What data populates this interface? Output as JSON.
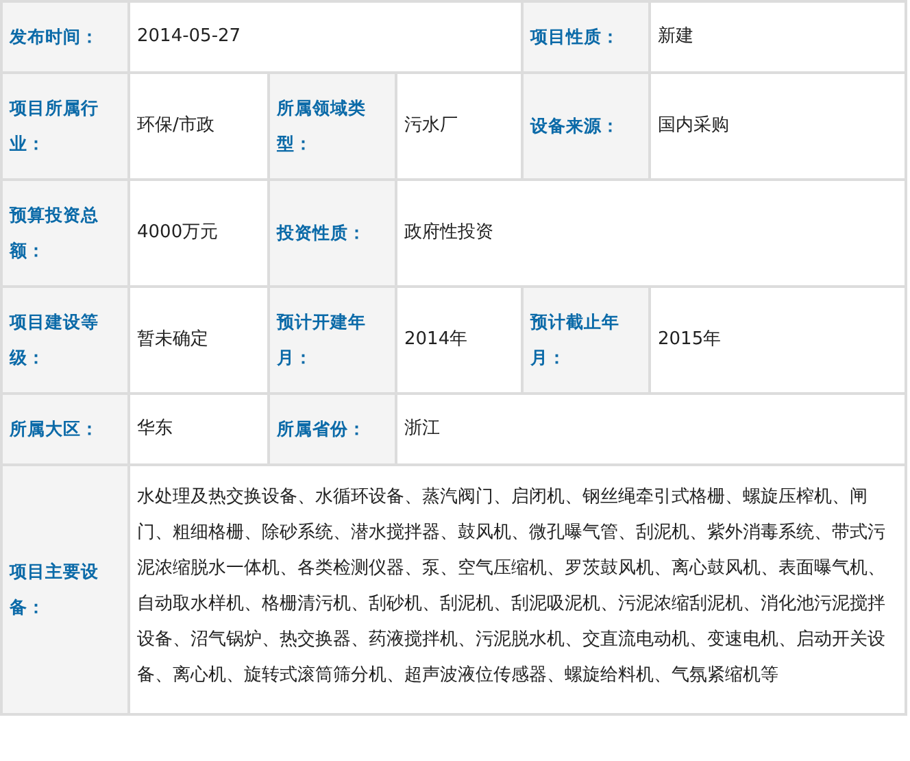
{
  "rows": [
    [
      {
        "kind": "label",
        "text": "发布时间："
      },
      {
        "kind": "value",
        "text": "2014-05-27"
      },
      {
        "kind": "label",
        "text": "项目性质："
      },
      {
        "kind": "value",
        "text": "新建"
      }
    ],
    [
      {
        "kind": "label",
        "text": "项目所属行业："
      },
      {
        "kind": "value",
        "text": "环保/市政"
      },
      {
        "kind": "label",
        "text": "所属领域类型："
      },
      {
        "kind": "value",
        "text": "污水厂"
      },
      {
        "kind": "label",
        "text": "设备来源："
      },
      {
        "kind": "value",
        "text": "国内采购"
      }
    ],
    [
      {
        "kind": "label",
        "text": "预算投资总额："
      },
      {
        "kind": "value",
        "text": "4000万元"
      },
      {
        "kind": "label",
        "text": "投资性质："
      },
      {
        "kind": "value",
        "text": "政府性投资"
      }
    ],
    [
      {
        "kind": "label",
        "text": "项目建设等级："
      },
      {
        "kind": "value",
        "text": "暂未确定"
      },
      {
        "kind": "label",
        "text": "预计开建年月："
      },
      {
        "kind": "value",
        "text": "2014年"
      },
      {
        "kind": "label",
        "text": "预计截止年月："
      },
      {
        "kind": "value",
        "text": "2015年"
      }
    ],
    [
      {
        "kind": "label",
        "text": "所属大区："
      },
      {
        "kind": "value",
        "text": "华东"
      },
      {
        "kind": "label",
        "text": "所属省份："
      },
      {
        "kind": "value",
        "text": "浙江"
      }
    ],
    [
      {
        "kind": "label",
        "text": "项目主要设备："
      },
      {
        "kind": "value",
        "text": "水处理及热交换设备、水循环设备、蒸汽阀门、启闭机、钢丝绳牵引式格栅、螺旋压榨机、闸门、粗细格栅、除砂系统、潜水搅拌器、鼓风机、微孔曝气管、刮泥机、紫外消毒系统、带式污泥浓缩脱水一体机、各类检测仪器、泵、空气压缩机、罗茨鼓风机、离心鼓风机、表面曝气机、自动取水样机、格栅清污机、刮砂机、刮泥机、刮泥吸泥机、污泥浓缩刮泥机、消化池污泥搅拌设备、沼气锅炉、热交换器、药液搅拌机、污泥脱水机、交直流电动机、变速电机、启动开关设备、离心机、旋转式滚筒筛分机、超声波液位传感器、螺旋给料机、气氛紧缩机等"
      }
    ]
  ]
}
